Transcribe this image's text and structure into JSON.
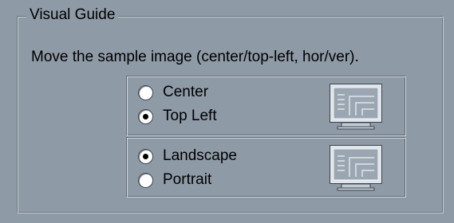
{
  "groupbox": {
    "title": "Visual Guide"
  },
  "instruction_text": "Move the sample image (center/top-left, hor/ver).",
  "position_options": [
    {
      "label": "Center",
      "selected": false
    },
    {
      "label": "Top Left",
      "selected": true
    }
  ],
  "orientation_options": [
    {
      "label": "Landscape",
      "selected": true
    },
    {
      "label": "Portrait",
      "selected": false
    }
  ],
  "colors": {
    "background": "#8e9aa6",
    "monitor_screen": "#9aa6b2"
  },
  "icons": {
    "position_preview": "monitor-icon",
    "orientation_preview": "monitor-icon"
  }
}
